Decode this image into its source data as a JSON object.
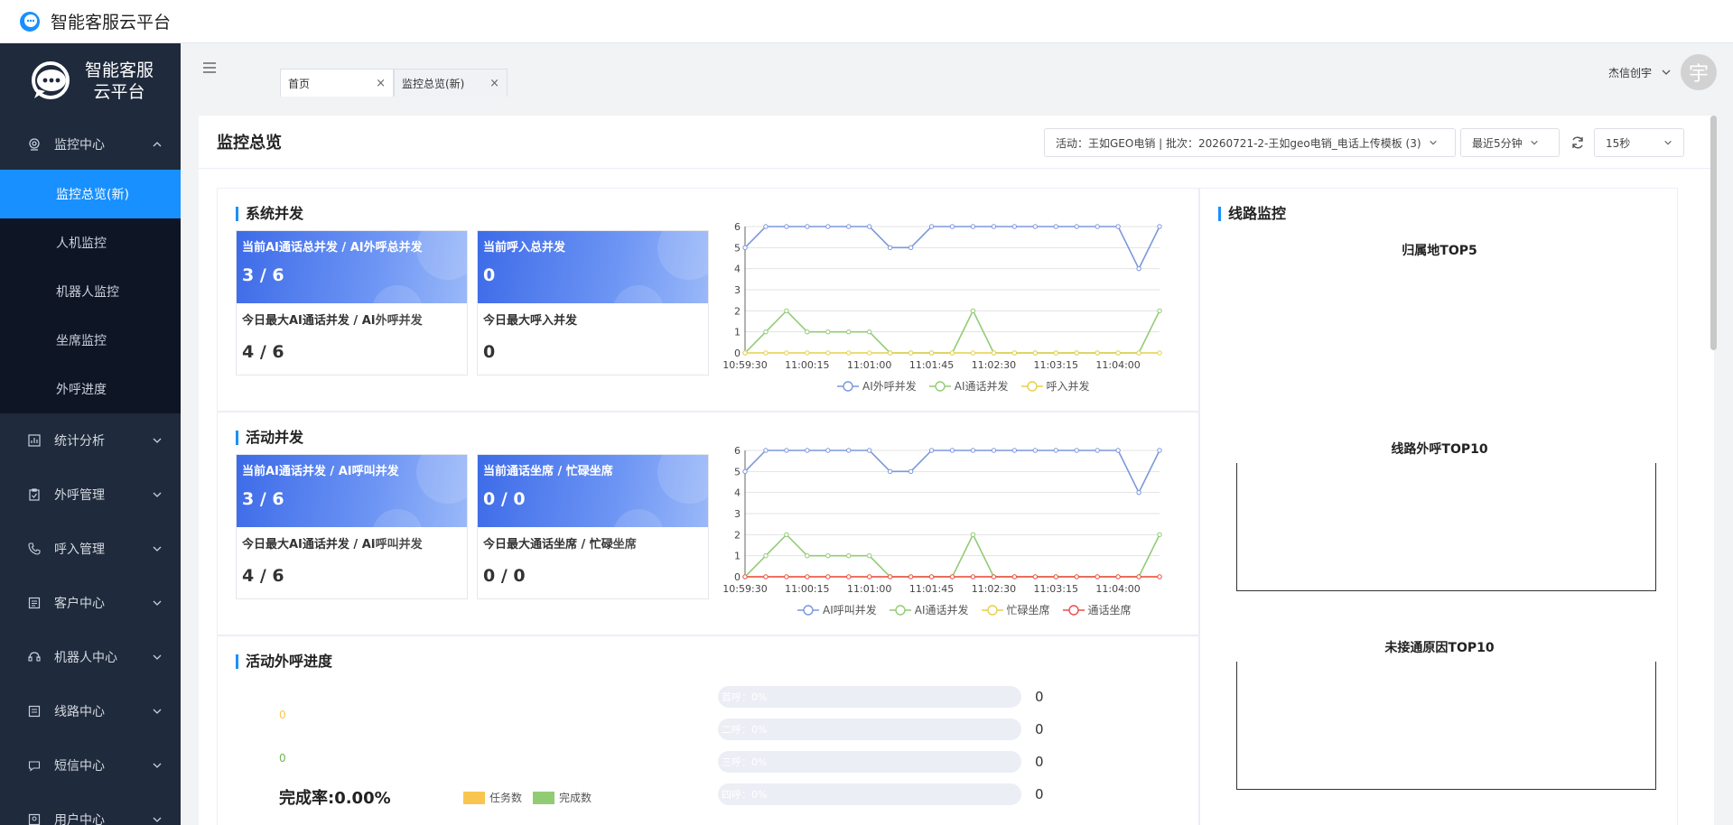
{
  "app": {
    "title": "智能客服云平台",
    "brand_line1": "智能客服",
    "brand_line2": "云平台"
  },
  "sidebar": {
    "items": [
      {
        "label": "监控中心",
        "icon": "monitor-icon",
        "expanded": true
      },
      {
        "label": "统计分析",
        "icon": "chart-icon"
      },
      {
        "label": "外呼管理",
        "icon": "clipboard-icon"
      },
      {
        "label": "呼入管理",
        "icon": "phone-icon"
      },
      {
        "label": "客户中心",
        "icon": "list-icon"
      },
      {
        "label": "机器人中心",
        "icon": "robot-icon"
      },
      {
        "label": "线路中心",
        "icon": "route-icon"
      },
      {
        "label": "短信中心",
        "icon": "message-icon"
      },
      {
        "label": "用户中心",
        "icon": "user-icon"
      }
    ],
    "submenu": [
      "监控总览(新)",
      "人机监控",
      "机器人监控",
      "坐席监控",
      "外呼进度"
    ],
    "active_sub": "监控总览(新)"
  },
  "tabs": [
    {
      "label": "首页",
      "close": "×"
    },
    {
      "label": "监控总览(新)",
      "close": "×"
    }
  ],
  "user": {
    "name": "杰信创宇",
    "avatar_char": "宇"
  },
  "page": {
    "title": "监控总览",
    "activity_filter": "活动：王如GEO电销 | 批次：20260721-2-王如geo电销_电话上传模板 (3)",
    "time_filter": "最近5分钟",
    "refresh_interval": "15秒"
  },
  "system": {
    "title": "系统并发",
    "card1": {
      "label": "当前AI通话总并发 / AI外呼总并发",
      "value": "3 / 6",
      "sub_label": "今日最大AI通话并发 / AI外呼并发",
      "sub_value": "4 / 6"
    },
    "card2": {
      "label": "当前呼入总并发",
      "value": "0",
      "sub_label": "今日最大呼入并发",
      "sub_value": "0"
    }
  },
  "activity": {
    "title": "活动并发",
    "card1": {
      "label": "当前AI通话并发 / AI呼叫并发",
      "value": "3 / 6",
      "sub_label": "今日最大AI通话并发 / AI呼叫并发",
      "sub_value": "4 / 6"
    },
    "card2": {
      "label": "当前通话坐席 / 忙碌坐席",
      "value": "0 / 0",
      "sub_label": "今日最大通话坐席 / 忙碌坐席",
      "sub_value": "0 / 0"
    }
  },
  "progress": {
    "title": "活动外呼进度",
    "task_count": "0",
    "done_count": "0",
    "rate_label": "完成率:0.00%",
    "legend": [
      {
        "name": "任务数",
        "color": "#f8c64f"
      },
      {
        "name": "完成数",
        "color": "#91cc75"
      }
    ],
    "bars": [
      {
        "label": "首呼：0%",
        "value": "0",
        "pct": 0
      },
      {
        "label": "二呼：0%",
        "value": "0",
        "pct": 0
      },
      {
        "label": "三呼：0%",
        "value": "0",
        "pct": 0
      },
      {
        "label": "四呼：0%",
        "value": "0",
        "pct": 0
      }
    ]
  },
  "line_monitor": {
    "title": "线路监控",
    "sub1": "归属地TOP5",
    "sub2": "线路外呼TOP10",
    "sub3": "未接通原因TOP10"
  },
  "chart_data": [
    {
      "type": "line",
      "x": [
        "10:59:30",
        "10:59:45",
        "11:00:00",
        "11:00:15",
        "11:00:30",
        "11:00:45",
        "11:01:00",
        "11:01:15",
        "11:01:30",
        "11:01:45",
        "11:02:00",
        "11:02:15",
        "11:02:30",
        "11:02:45",
        "11:03:00",
        "11:03:15",
        "11:03:30",
        "11:03:45",
        "11:04:00",
        "11:04:15"
      ],
      "xticks": [
        "10:59:30",
        "11:00:15",
        "11:01:00",
        "11:01:45",
        "11:02:30",
        "11:03:15",
        "11:04:00"
      ],
      "ylim": [
        0,
        6
      ],
      "yticks": [
        "0",
        "1",
        "2",
        "3",
        "4",
        "5",
        "6"
      ],
      "series": [
        {
          "name": "AI外呼并发",
          "color": "#7b97dd",
          "values": [
            5,
            6,
            6,
            6,
            6,
            6,
            6,
            5,
            5,
            6,
            6,
            6,
            6,
            6,
            6,
            6,
            6,
            6,
            6,
            4,
            6
          ]
        },
        {
          "name": "AI通话并发",
          "color": "#91cc75",
          "values": [
            0,
            1,
            2,
            1,
            1,
            1,
            1,
            0,
            0,
            0,
            0,
            2,
            0,
            0,
            0,
            0,
            0,
            0,
            0,
            0,
            2
          ]
        },
        {
          "name": "呼入并发",
          "color": "#e5d04a",
          "values": [
            0,
            0,
            0,
            0,
            0,
            0,
            0,
            0,
            0,
            0,
            0,
            0,
            0,
            0,
            0,
            0,
            0,
            0,
            0,
            0,
            0
          ]
        }
      ]
    },
    {
      "type": "line",
      "x": [
        "10:59:30",
        "10:59:45",
        "11:00:00",
        "11:00:15",
        "11:00:30",
        "11:00:45",
        "11:01:00",
        "11:01:15",
        "11:01:30",
        "11:01:45",
        "11:02:00",
        "11:02:15",
        "11:02:30",
        "11:02:45",
        "11:03:00",
        "11:03:15",
        "11:03:30",
        "11:03:45",
        "11:04:00",
        "11:04:15"
      ],
      "xticks": [
        "10:59:30",
        "11:00:15",
        "11:01:00",
        "11:01:45",
        "11:02:30",
        "11:03:15",
        "11:04:00"
      ],
      "ylim": [
        0,
        6
      ],
      "yticks": [
        "0",
        "1",
        "2",
        "3",
        "4",
        "5",
        "6"
      ],
      "series": [
        {
          "name": "AI呼叫并发",
          "color": "#7b97dd",
          "values": [
            5,
            6,
            6,
            6,
            6,
            6,
            6,
            5,
            5,
            6,
            6,
            6,
            6,
            6,
            6,
            6,
            6,
            6,
            6,
            4,
            6
          ]
        },
        {
          "name": "AI通话并发",
          "color": "#91cc75",
          "values": [
            0,
            1,
            2,
            1,
            1,
            1,
            1,
            0,
            0,
            0,
            0,
            2,
            0,
            0,
            0,
            0,
            0,
            0,
            0,
            0,
            2
          ]
        },
        {
          "name": "忙碌坐席",
          "color": "#e5d04a",
          "values": [
            0,
            0,
            0,
            0,
            0,
            0,
            0,
            0,
            0,
            0,
            0,
            0,
            0,
            0,
            0,
            0,
            0,
            0,
            0,
            0,
            0
          ]
        },
        {
          "name": "通话坐席",
          "color": "#ee4b4b",
          "values": [
            0,
            0,
            0,
            0,
            0,
            0,
            0,
            0,
            0,
            0,
            0,
            0,
            0,
            0,
            0,
            0,
            0,
            0,
            0,
            0,
            0
          ]
        }
      ]
    }
  ]
}
